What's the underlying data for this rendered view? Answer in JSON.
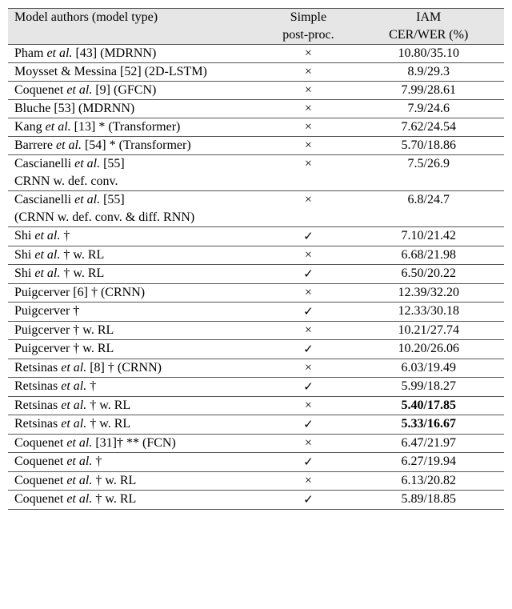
{
  "chart_data": {
    "type": "table",
    "title": "",
    "columns": [
      "Model authors (model type)",
      "Simple post-proc.",
      "IAM CER/WER (%)"
    ],
    "groups": [
      {
        "rows": [
          {
            "author": "Pham et al. [43] (MDRNN)",
            "pp": "×",
            "res": "10.80/35.10",
            "bold": false
          },
          {
            "author": "Moysset & Messina [52] (2D-LSTM)",
            "pp": "×",
            "res": "8.9/29.3",
            "bold": false
          },
          {
            "author": "Coquenet et al. [9] (GFCN)",
            "pp": "×",
            "res": "7.99/28.61",
            "bold": false
          },
          {
            "author": "Bluche [53] (MDRNN)",
            "pp": "×",
            "res": "7.9/24.6",
            "bold": false
          },
          {
            "author": "Kang et al. [13] * (Transformer)",
            "pp": "×",
            "res": "7.62/24.54",
            "bold": false
          },
          {
            "author": "Barrere et al. [54] * (Transformer)",
            "pp": "×",
            "res": "5.70/18.86",
            "bold": false
          },
          {
            "author": "Cascianelli et al. [55]",
            "pp": "×",
            "res": "7.5/26.9",
            "bold": false,
            "sub": "CRNN w. def. conv."
          },
          {
            "author": "Cascianelli et al. [55]",
            "pp": "×",
            "res": "6.8/24.7",
            "bold": false,
            "sub": "(CRNN w. def. conv. & diff. RNN)"
          }
        ]
      },
      {
        "rows": [
          {
            "author": "Shi et al. †",
            "pp": "✓",
            "res": "7.10/21.42",
            "bold": false
          },
          {
            "author": "Shi et al. † w. RL",
            "pp": "×",
            "res": "6.68/21.98",
            "bold": false
          },
          {
            "author": "Shi et al. † w. RL",
            "pp": "✓",
            "res": "6.50/20.22",
            "bold": false
          },
          {
            "author": "Puigcerver [6] † (CRNN)",
            "pp": "×",
            "res": "12.39/32.20",
            "bold": false
          },
          {
            "author": "Puigcerver †",
            "pp": "✓",
            "res": "12.33/30.18",
            "bold": false
          },
          {
            "author": "Puigcerver † w. RL",
            "pp": "×",
            "res": "10.21/27.74",
            "bold": false
          },
          {
            "author": "Puigcerver † w. RL",
            "pp": "✓",
            "res": "10.20/26.06",
            "bold": false
          },
          {
            "author": "Retsinas et al. [8] † (CRNN)",
            "pp": "×",
            "res": "6.03/19.49",
            "bold": false
          },
          {
            "author": "Retsinas et al. †",
            "pp": "✓",
            "res": "5.99/18.27",
            "bold": false
          },
          {
            "author": "Retsinas et al. † w. RL",
            "pp": "×",
            "res": "5.40/17.85",
            "bold": true
          },
          {
            "author": "Retsinas et al. † w. RL",
            "pp": "✓",
            "res": "5.33/16.67",
            "bold": true
          },
          {
            "author": "Coquenet et al. [31]† ** (FCN)",
            "pp": "×",
            "res": "6.47/21.97",
            "bold": false
          },
          {
            "author": "Coquenet et al. †",
            "pp": "✓",
            "res": "6.27/19.94",
            "bold": false
          },
          {
            "author": "Coquenet et al. † w. RL",
            "pp": "×",
            "res": "6.13/20.82",
            "bold": false
          },
          {
            "author": "Coquenet et al. † w. RL",
            "pp": "✓",
            "res": "5.89/18.85",
            "bold": false
          }
        ]
      }
    ]
  },
  "header": {
    "c0a": "Model authors (model type)",
    "c1a": "Simple",
    "c1b": "post-proc.",
    "c2a": "IAM",
    "c2b": "CER/WER (%)"
  },
  "symbols": {
    "check": "✓",
    "cross": "×"
  }
}
